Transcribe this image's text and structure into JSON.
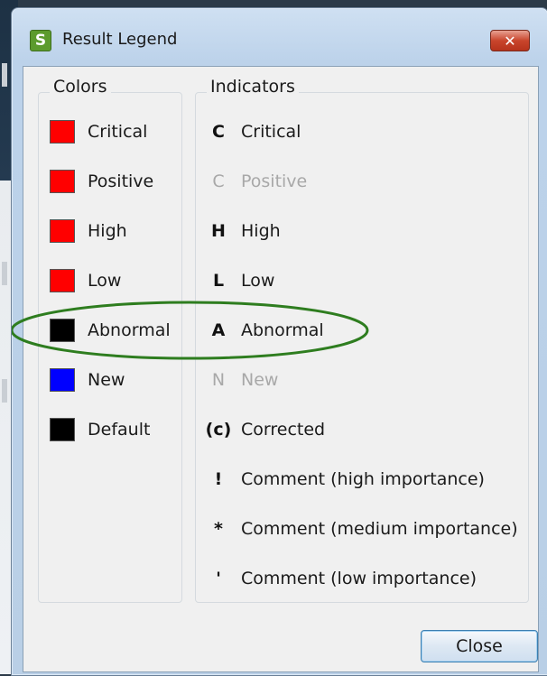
{
  "window": {
    "title": "Result Legend",
    "app_icon_letter": "S",
    "close_glyph": "✕"
  },
  "colors": {
    "legend": "Colors",
    "items": [
      {
        "label": "Critical",
        "color": "#ff0000"
      },
      {
        "label": "Positive",
        "color": "#ff0000"
      },
      {
        "label": "High",
        "color": "#ff0000"
      },
      {
        "label": "Low",
        "color": "#ff0000"
      },
      {
        "label": "Abnormal",
        "color": "#000000"
      },
      {
        "label": "New",
        "color": "#0000ff"
      },
      {
        "label": "Default",
        "color": "#000000"
      }
    ]
  },
  "indicators": {
    "legend": "Indicators",
    "items": [
      {
        "code": "C",
        "label": "Critical",
        "disabled": false
      },
      {
        "code": "C",
        "label": "Positive",
        "disabled": true
      },
      {
        "code": "H",
        "label": "High",
        "disabled": false
      },
      {
        "code": "L",
        "label": "Low",
        "disabled": false
      },
      {
        "code": "A",
        "label": "Abnormal",
        "disabled": false
      },
      {
        "code": "N",
        "label": "New",
        "disabled": true
      },
      {
        "code": "(c)",
        "label": "Corrected",
        "disabled": false
      },
      {
        "code": "!",
        "label": "Comment (high importance)",
        "disabled": false
      },
      {
        "code": "*",
        "label": "Comment (medium importance)",
        "disabled": false
      },
      {
        "code": "'",
        "label": "Comment (low importance)",
        "disabled": false
      }
    ]
  },
  "buttons": {
    "close_label": "Close"
  },
  "annotation": {
    "highlight_color": "#2e7d1f",
    "highlighted_row": "Abnormal"
  }
}
